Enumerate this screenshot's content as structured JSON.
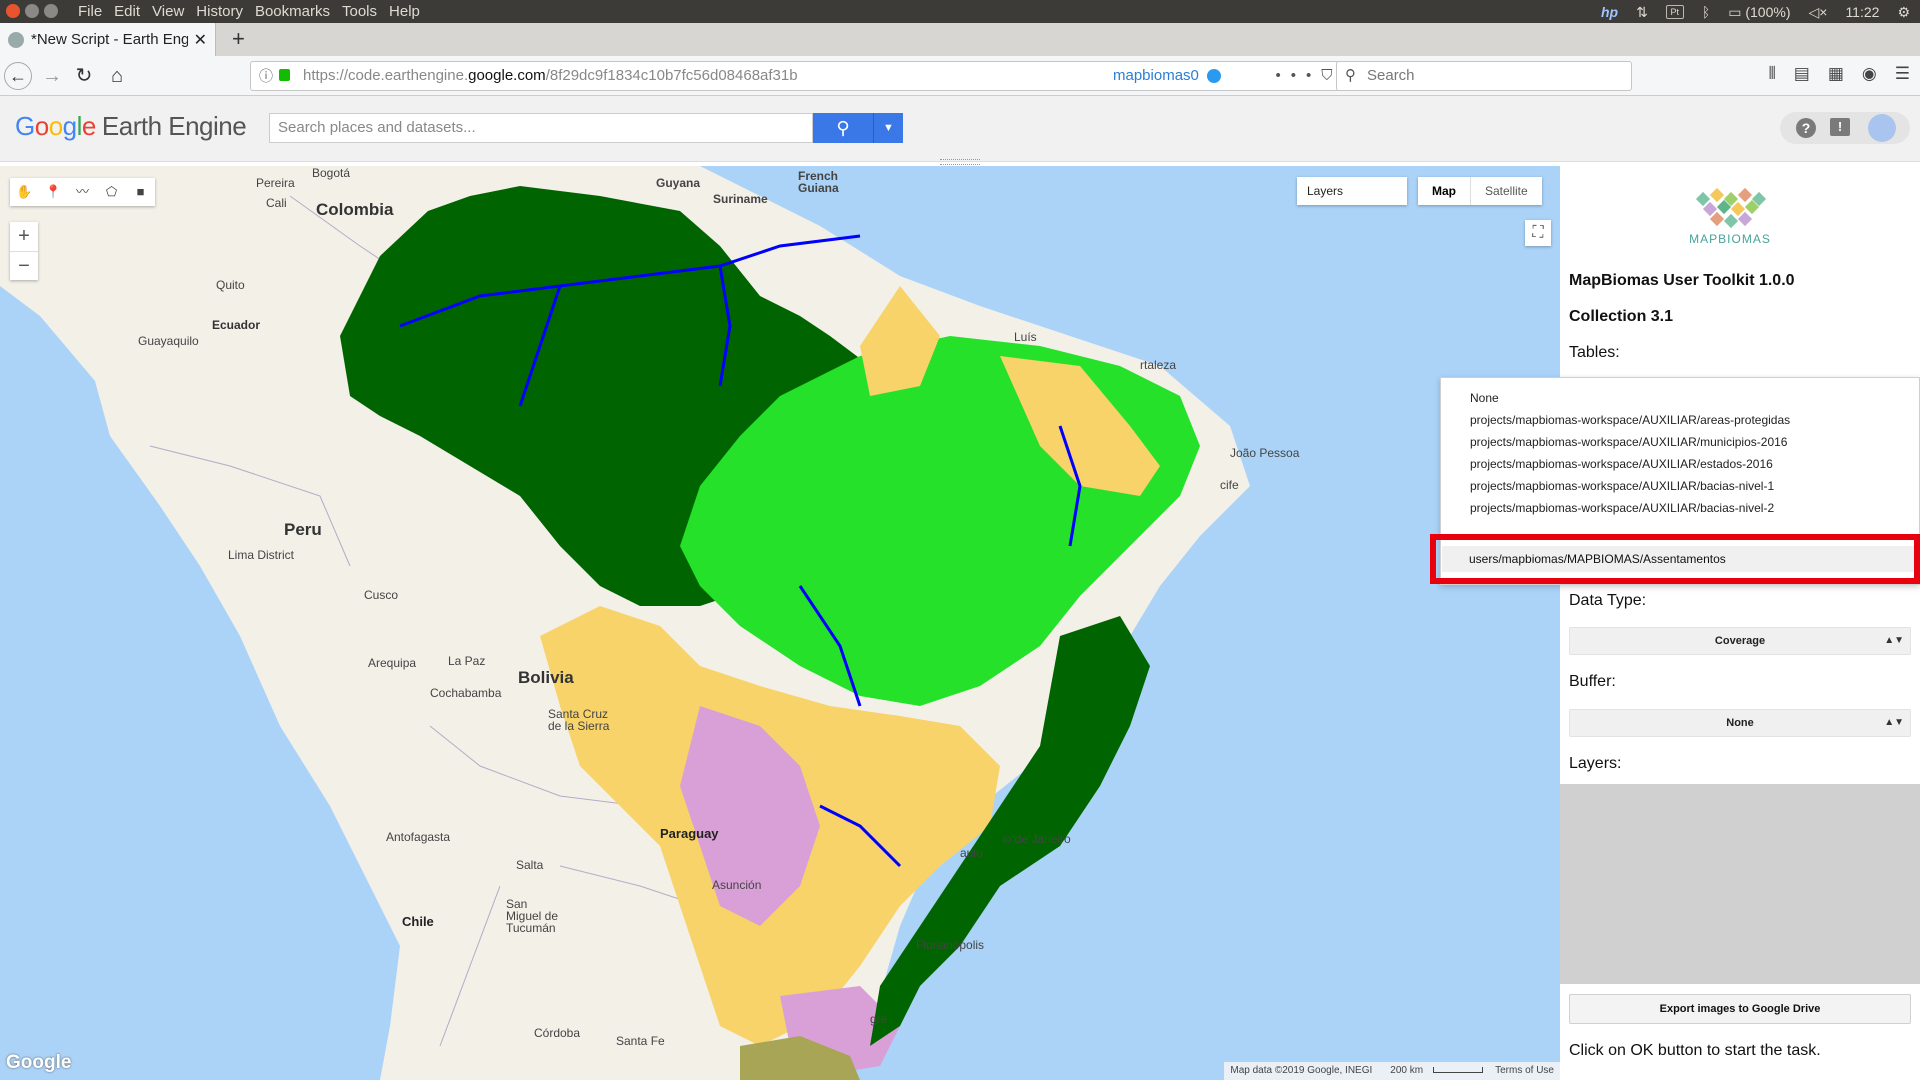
{
  "os": {
    "menu": [
      "File",
      "Edit",
      "View",
      "History",
      "Bookmarks",
      "Tools",
      "Help"
    ],
    "lang": "Pt",
    "battery": "(100%)",
    "clock": "11:22"
  },
  "browser": {
    "tab_title": "*New Script - Earth Engi",
    "url_prefix": "https://code.earthengine.",
    "url_domain": "google.com",
    "url_path": "/8f29dc9f1834c10b7fc56d08468af31b",
    "account": "mapbiomas0",
    "search_placeholder": "Search"
  },
  "gee": {
    "logo_google": [
      "G",
      "o",
      "o",
      "g",
      "l",
      "e"
    ],
    "logo_product": "Earth Engine",
    "search_placeholder": "Search places and datasets..."
  },
  "map": {
    "layers_label": "Layers",
    "maptype": [
      "Map",
      "Satellite"
    ],
    "watermark": "Google",
    "attribution": [
      "Map data ©2019 Google, INEGI",
      "200 km",
      "Terms of Use"
    ],
    "labels": {
      "colombia": "Colombia",
      "peru": "Peru",
      "bolivia": "Bolivia",
      "paraguay": "Paraguay",
      "chile": "Chile",
      "bogota": "Bogotá",
      "pereira": "Pereira",
      "cali": "Cali",
      "quito": "Quito",
      "ecuador": "Ecuador",
      "guayaquilo": "Guayaquilo",
      "guyana": "Guyana",
      "suriname": "Suriname",
      "french_guiana": "French Guiana",
      "lima": "Lima District",
      "cusco": "Cusco",
      "arequipa": "Arequipa",
      "la_paz": "La Paz",
      "cochabamba": "Cochabamba",
      "santa_cruz": "Santa Cruz de la Sierra",
      "antofagasta": "Antofagasta",
      "salta": "Salta",
      "asuncion": "Asunción",
      "tucuman": "San Miguel de Tucumán",
      "cordoba": "Córdoba",
      "santa_fe": "Santa Fe",
      "luis": "Luís",
      "fortaleza": "rtaleza",
      "joao_pessoa": "João Pessoa",
      "recife": "cife",
      "rio": "io de Janeiro",
      "paulo": "aulo",
      "florianopolis": "Florianópolis",
      "alegre": "gre"
    }
  },
  "panel": {
    "logo_text": "MAPBIOMAS",
    "title": "MapBiomas User Toolkit 1.0.0",
    "collection": "Collection 3.1",
    "tables_label": "Tables:",
    "data_type_label": "Data Type:",
    "data_type_value": "Coverage",
    "buffer_label": "Buffer:",
    "buffer_value": "None",
    "layers_label": "Layers:",
    "export_button": "Export images to Google Drive",
    "status_text": "Click on OK button to start the task."
  },
  "tables_dropdown": {
    "options": [
      "None",
      "projects/mapbiomas-workspace/AUXILIAR/areas-protegidas",
      "projects/mapbiomas-workspace/AUXILIAR/municipios-2016",
      "projects/mapbiomas-workspace/AUXILIAR/estados-2016",
      "projects/mapbiomas-workspace/AUXILIAR/bacias-nivel-1",
      "projects/mapbiomas-workspace/AUXILIAR/bacias-nivel-2"
    ],
    "highlighted": "users/mapbiomas/MAPBIOMAS/Assentamentos"
  },
  "colors": {
    "forest": "#006400",
    "savanna": "#00ff00",
    "farming": "#ffd966",
    "pasture": "#e974ed",
    "water": "#0000ff",
    "ocean": "#abd3f8",
    "land": "#f3f0e8",
    "highlight": "#e8000e"
  }
}
